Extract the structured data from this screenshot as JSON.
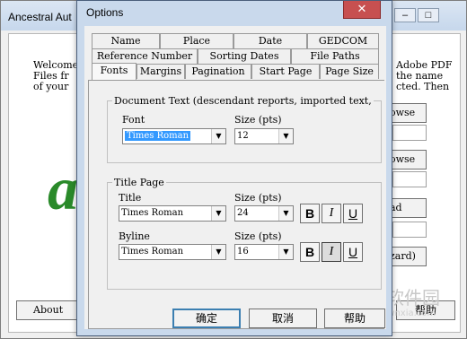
{
  "background": {
    "title": "Ancestral Aut",
    "minimize": "–",
    "restore": "□",
    "welcome_lines": [
      "Welcome",
      "Files fr",
      "of your"
    ],
    "right_lines": [
      "Adobe PDF",
      "the name",
      "cted. Then"
    ],
    "buttons": [
      "owse",
      "owse",
      "ad New",
      "zard)"
    ],
    "about_label": "About",
    "help_label": "帮助",
    "logo_glyph": "a"
  },
  "dialog": {
    "title": "Options",
    "close": "✕",
    "tabs_row1": [
      "Name",
      "Place",
      "Date",
      "GEDCOM"
    ],
    "tabs_row2": [
      "Reference Number",
      "Sorting Dates",
      "File Paths"
    ],
    "tabs_row3": [
      "Fonts",
      "Margins",
      "Pagination",
      "Start Page",
      "Page Size"
    ],
    "document_text": {
      "legend": "Document Text (descendant reports, imported text,",
      "font_label": "Font",
      "font_value": "Times Roman",
      "size_label": "Size (pts)",
      "size_value": "12"
    },
    "title_page": {
      "legend": "Title Page",
      "title_label": "Title",
      "title_font": "Times Roman",
      "title_size_label": "Size (pts)",
      "title_size": "24",
      "byline_label": "Byline",
      "byline_font": "Times Roman",
      "byline_size_label": "Size (pts)",
      "byline_size": "16",
      "bold": "B",
      "italic": "I",
      "underline": "U"
    },
    "ok": "确定",
    "cancel": "取消",
    "help": "帮助"
  },
  "watermark": {
    "text": "当下软件园",
    "url": "www.downxia.com"
  }
}
